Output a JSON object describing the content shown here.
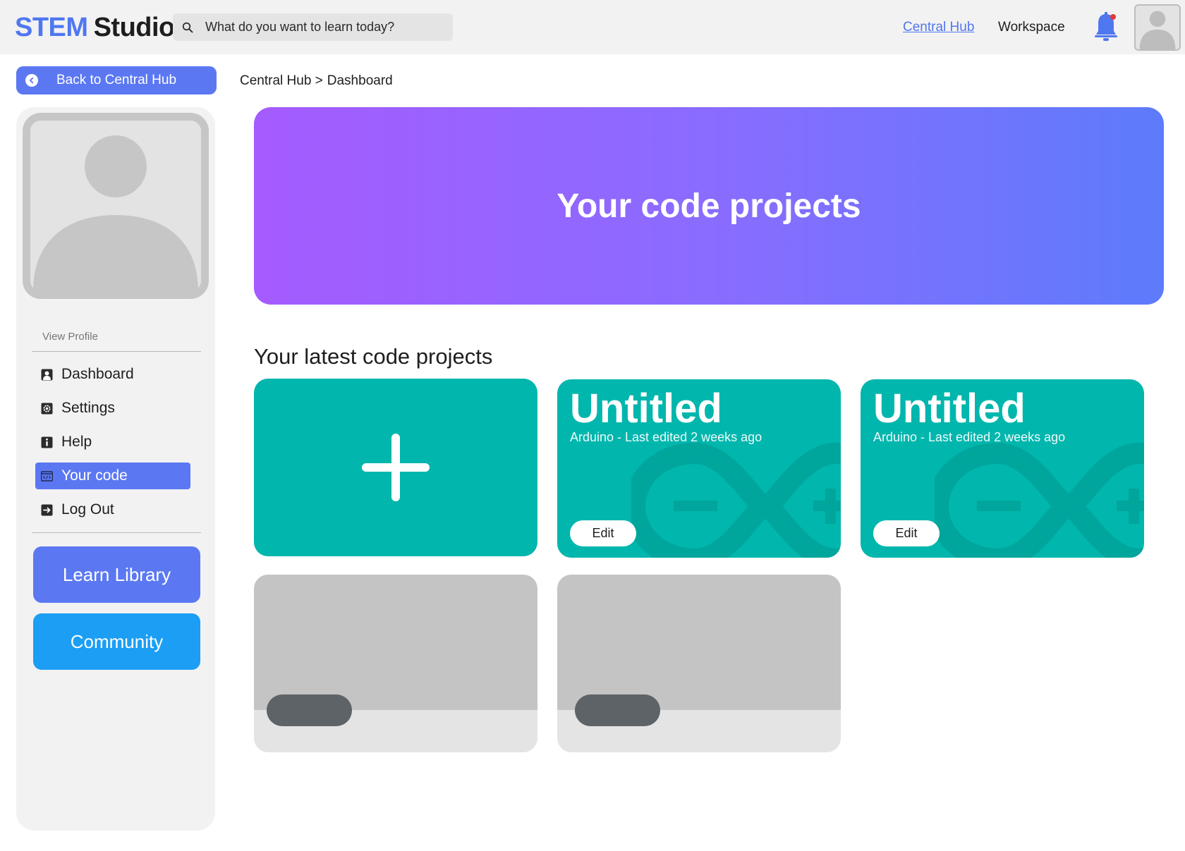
{
  "app": {
    "logo_part1": "STEM",
    "logo_part2": "Studio"
  },
  "search": {
    "placeholder": "What do you want to learn today?"
  },
  "topnav": {
    "central_hub": "Central Hub",
    "workspace": "Workspace"
  },
  "back_button": {
    "label": "Back to Central Hub"
  },
  "breadcrumb": {
    "item1": "Central Hub >",
    "item2": "Dashboard"
  },
  "sidebar": {
    "view_profile": "View Profile",
    "menu": [
      {
        "label": "Dashboard",
        "icon": "dashboard-icon"
      },
      {
        "label": "Settings",
        "icon": "settings-icon"
      },
      {
        "label": "Help",
        "icon": "info-icon"
      },
      {
        "label": "Your code",
        "icon": "code-icon",
        "active": true
      },
      {
        "label": "Log Out",
        "icon": "logout-icon"
      }
    ],
    "learn_library": "Learn Library",
    "community": "Community"
  },
  "hero": {
    "title": "Your code projects"
  },
  "main": {
    "section_title": "Your latest code projects",
    "projects": [
      {
        "title": "Untitled",
        "meta": "Arduino - Last edited 2 weeks ago",
        "edit_label": "Edit"
      },
      {
        "title": "Untitled",
        "meta": "Arduino - Last edited 2 weeks ago",
        "edit_label": "Edit"
      }
    ]
  },
  "colors": {
    "brand_blue": "#5b78f2",
    "community_blue": "#1b9ef4",
    "teal": "#00b6ad",
    "notification_dot": "#e53935"
  }
}
